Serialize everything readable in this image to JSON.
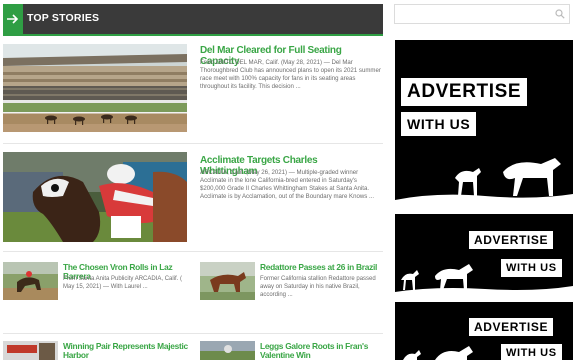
{
  "section": {
    "title": "TOP STORIES"
  },
  "stories": [
    {
      "headline": "Del Mar Cleared for Full Seating Capacity",
      "excerpt": "From DMTC DEL MAR, Calif. (May 28, 2021) — Del Mar Thoroughbred Club has announced plans to open its 2021 summer race meet with 100% capacity for fans in its seating areas throughout its facility. This decision",
      "more": "..."
    },
    {
      "headline": "Acclimate Targets Charles Whittingham",
      "excerpt": "ARCADIA, Calif. (May 26, 2021) — Multiple-graded winner Acclimate in the lone California-bred entered in Saturday's $200,000 Grade II Charles Whittingham Stakes at Santa Anita. Acclimate is by Acclamation, out of the Boundary mare Knows",
      "more": "..."
    },
    {
      "headline": "The Chosen Vron Rolls in Laz Barrera",
      "excerpt": "From Santa Anita Publicity ARCADIA, Calif. ( May 15, 2021) — With Laurel",
      "more": "..."
    },
    {
      "headline": "Redattore Passes at 26 in Brazil",
      "excerpt": "Former California stallion Redattore passed away on Saturday in his native Brazil, according",
      "more": "..."
    },
    {
      "headline": "Winning Pair Represents Majestic Harbor"
    },
    {
      "headline": "Leggs Galore Roots in Fran's Valentine Win"
    }
  ],
  "sidebar": {
    "search": {
      "placeholder": ""
    },
    "ads": [
      {
        "line1": "ADVERTISE",
        "line2": "WITH US"
      },
      {
        "line1": "ADVERTISE",
        "line2": "WITH US"
      },
      {
        "line1": "ADVERTISE",
        "line2": "WITH US"
      }
    ]
  },
  "colors": {
    "accent": "#3aa646",
    "header_bg": "#3a3a3a",
    "ad_bg": "#000000"
  },
  "icons": [
    "arrow-right-icon",
    "search-icon"
  ]
}
